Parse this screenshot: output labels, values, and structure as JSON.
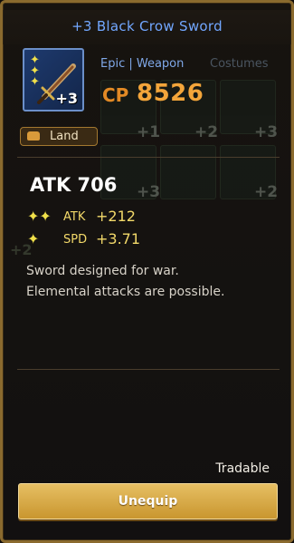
{
  "item": {
    "name": "+3 Black Crow Sword",
    "rarity_type": "Epic | Weapon",
    "enhance_level": "+3",
    "cp_label": "CP",
    "cp_value": "8526",
    "tag": "Land",
    "main_stat": "ATK 706",
    "stats": [
      {
        "name": "ATK",
        "value": "+212",
        "icon": "double-sparkle-icon"
      },
      {
        "name": "SPD",
        "value": "+3.71",
        "icon": "sparkle-icon"
      }
    ],
    "description": "Sword designed for war. Elemental attacks are possible.",
    "tradable": "Tradable"
  },
  "background": {
    "tab_costumes": "Costumes",
    "tile_plus": [
      "+1",
      "+2",
      "+3",
      "+3",
      "+2"
    ],
    "side_plus": [
      "+2"
    ]
  },
  "actions": {
    "unequip_label": "Unequip"
  },
  "colors": {
    "title": "#72a7ff",
    "cp": "#f3a53a",
    "button": "#d9ab48",
    "accent_border": "#8a6a2e"
  }
}
